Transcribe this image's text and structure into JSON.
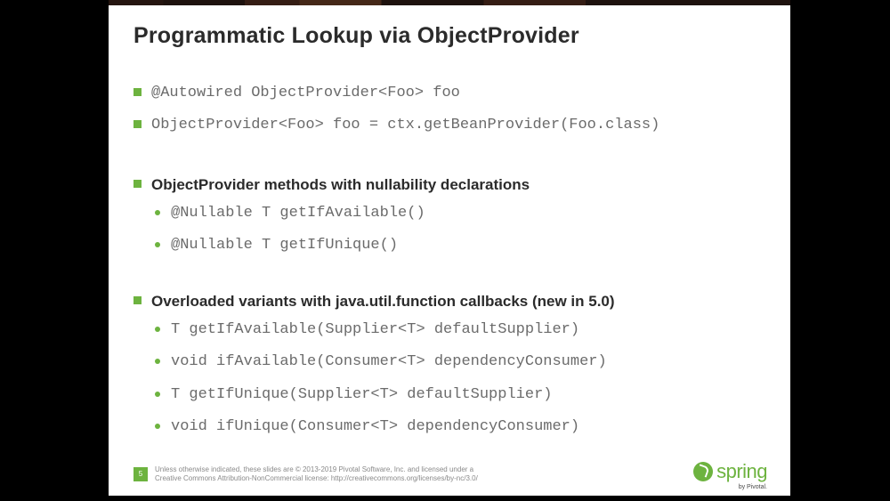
{
  "title": "Programmatic Lookup via ObjectProvider",
  "section1": {
    "item1": "@Autowired ObjectProvider<Foo> foo",
    "item2": "ObjectProvider<Foo> foo = ctx.getBeanProvider(Foo.class)"
  },
  "section2": {
    "heading": "ObjectProvider methods with nullability declarations",
    "items": [
      "@Nullable T getIfAvailable()",
      "@Nullable T getIfUnique()"
    ]
  },
  "section3": {
    "heading": "Overloaded variants with java.util.function callbacks (new in 5.0)",
    "items": [
      "T getIfAvailable(Supplier<T> defaultSupplier)",
      "void ifAvailable(Consumer<T> dependencyConsumer)",
      "T getIfUnique(Supplier<T> defaultSupplier)",
      "void ifUnique(Consumer<T> dependencyConsumer)"
    ]
  },
  "footer": {
    "page": "5",
    "line1": "Unless otherwise indicated, these slides are © 2013-2019 Pivotal Software, Inc. and licensed under a",
    "line2": "Creative Commons Attribution-NonCommercial license: http://creativecommons.org/licenses/by-nc/3.0/"
  },
  "logo": {
    "text": "spring",
    "sub": "by Pivotal."
  }
}
